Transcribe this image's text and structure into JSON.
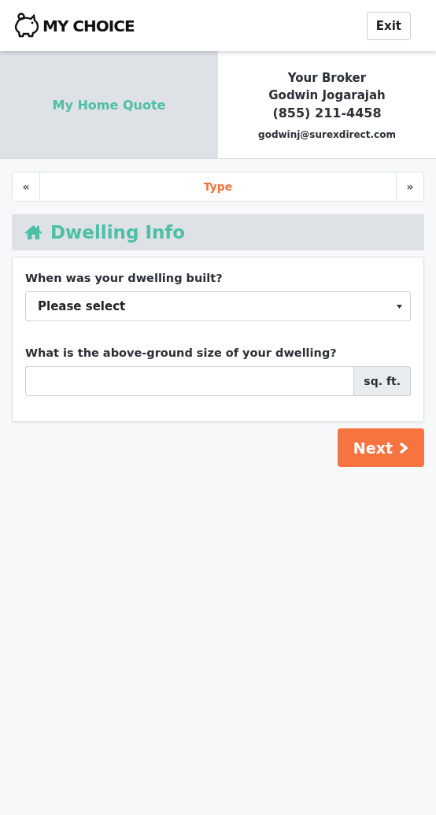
{
  "header": {
    "logo_text": "MY CHOICE",
    "exit_button": "Exit"
  },
  "banner": {
    "title": "My Home Quote",
    "broker_label": "Your Broker",
    "broker_name": "Godwin Jogarajah",
    "phone": "(855) 211-4458",
    "email": "godwinj@surexdirect.com"
  },
  "step_nav": {
    "prev": "«",
    "current": "Type",
    "next": "»"
  },
  "section": {
    "title": "Dwelling Info",
    "fields": [
      {
        "kind": "select",
        "label": "When was your dwelling built?",
        "value": "Please select"
      },
      {
        "kind": "input",
        "label": "What is the above-ground size of your dwelling?",
        "addon": "sq. ft."
      }
    ]
  },
  "next_button": "Next"
}
